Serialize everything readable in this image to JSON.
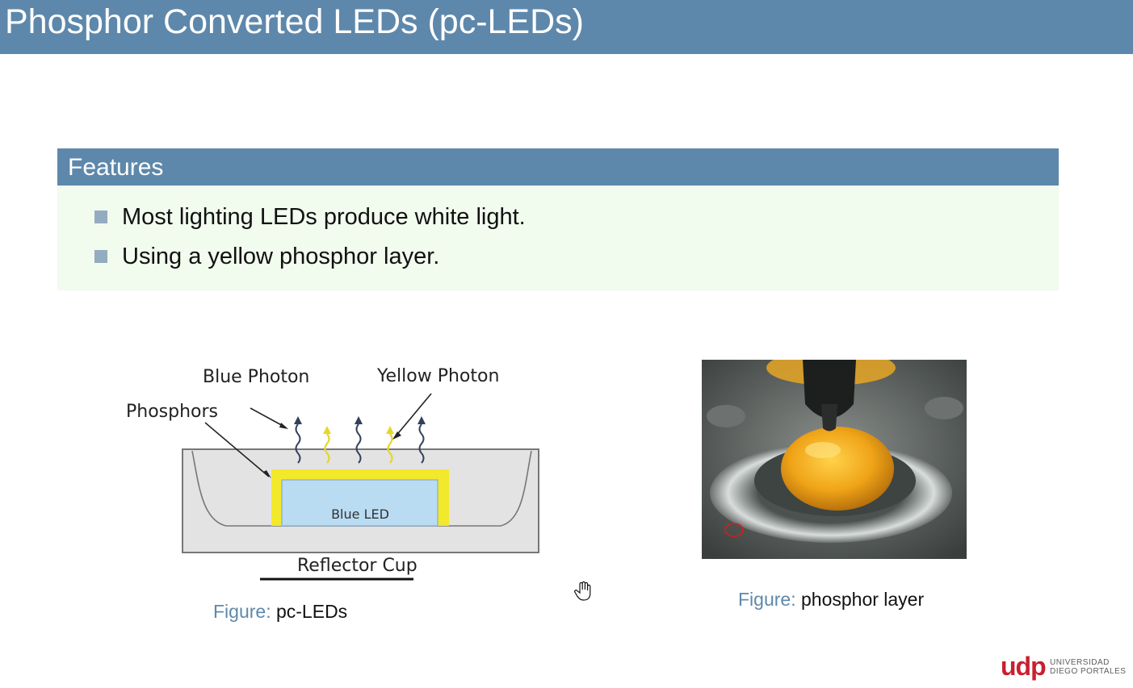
{
  "slide": {
    "title": "Phosphor Converted LEDs (pc-LEDs)"
  },
  "features_block": {
    "header": "Features",
    "bullets": [
      "Most lighting LEDs produce white light.",
      "Using a yellow phosphor layer."
    ]
  },
  "diagram": {
    "labels": {
      "blue_photon": "Blue Photon",
      "yellow_photon": "Yellow Photon",
      "phosphors": "Phosphors",
      "blue_led": "Blue LED",
      "reflector_cup": "Reflector Cup"
    },
    "colors": {
      "phosphor_yellow": "#f2e82c",
      "led_blue": "#b9dcf2",
      "cup_gray": "#e3e3e3"
    }
  },
  "captions": {
    "left": {
      "prefix": "Figure:",
      "text": "pc-LEDs"
    },
    "right": {
      "prefix": "Figure:",
      "text": "phosphor layer"
    }
  },
  "logo": {
    "mark": "udp",
    "line1": "UNIVERSIDAD",
    "line2": "DIEGO PORTALES"
  },
  "theme": {
    "accent": "#5e88ab",
    "block_body_bg": "#f1fbee",
    "bullet_square": "#94acc0",
    "logo_red": "#c8202f"
  }
}
